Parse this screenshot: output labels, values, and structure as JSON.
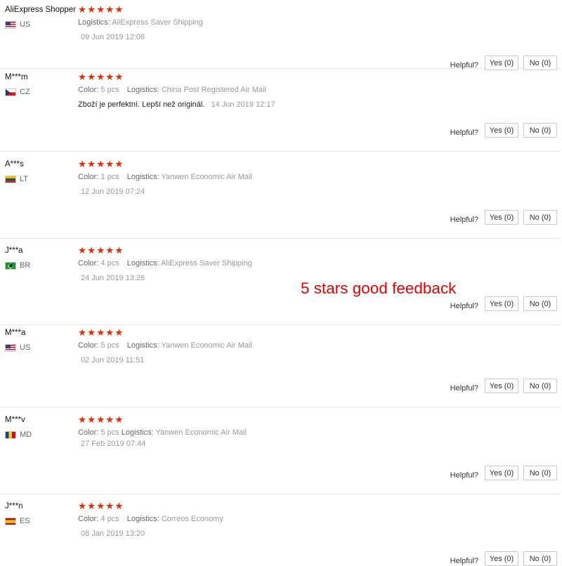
{
  "labels": {
    "color": "Color:",
    "logistics": "Logistics:",
    "helpful": "Helpful?",
    "yes": "Yes (0)",
    "no": "No (0)"
  },
  "stars": "★★★★★",
  "annotation": "5 stars good feedback",
  "reviews": [
    {
      "name": "AliExpress Shopper",
      "country": "US",
      "flag": "us",
      "rating": 5,
      "color": "",
      "logistics": "AliExpress Saver Shipping",
      "text": "",
      "date": "09 Jun 2019 12:06"
    },
    {
      "name": "M***m",
      "country": "CZ",
      "flag": "cz",
      "rating": 5,
      "color": "5 pcs",
      "logistics": "China Post Registered Air Mail",
      "text": "Zboží je perfektní. Lepší než originál.",
      "date": "14 Jun 2019 12:17"
    },
    {
      "name": "A***s",
      "country": "LT",
      "flag": "lt",
      "rating": 5,
      "color": "1 pcs",
      "logistics": "Yanwen Economic Air Mail",
      "text": "",
      "date": "12 Jun 2019 07:24"
    },
    {
      "name": "J***a",
      "country": "BR",
      "flag": "br",
      "rating": 5,
      "color": "4 pcs",
      "logistics": "AliExpress Saver Shipping",
      "text": "",
      "date": "24 Jun 2019 13:26"
    },
    {
      "name": "M***a",
      "country": "US",
      "flag": "us",
      "rating": 5,
      "color": "5 pcs",
      "logistics": "Yanwen Economic Air Mail",
      "text": "",
      "date": "02 Jun 2019 11:51"
    },
    {
      "name": "M***v",
      "country": "MD",
      "flag": "md",
      "rating": 5,
      "color": "5 pcs",
      "logistics": "Yanwen Economic Air Mail",
      "text": "",
      "date": "27 Feb 2019 07:44"
    },
    {
      "name": "J***n",
      "country": "ES",
      "flag": "es",
      "rating": 5,
      "color": "4 pcs",
      "logistics": "Correos Economy",
      "text": "",
      "date": "08 Jan 2019 13:20"
    }
  ]
}
